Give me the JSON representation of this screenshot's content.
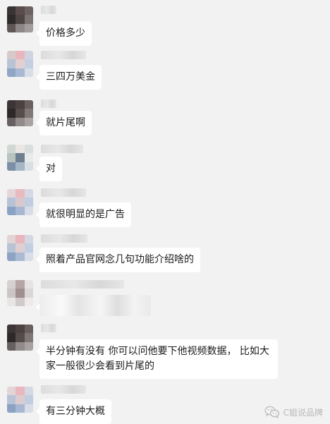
{
  "messages": [
    {
      "text": "价格多少"
    },
    {
      "text": "三四万美金"
    },
    {
      "text": "就片尾啊"
    },
    {
      "text": "对"
    },
    {
      "text": "就很明显的是广告"
    },
    {
      "text": "照着产品官网念几句功能介绍啥的"
    },
    {
      "text": ""
    },
    {
      "text": "半分钟有没有  你可以问他要下他视频数据， 比如大家一般很少会看到片尾的"
    },
    {
      "text": "有三分钟大概"
    }
  ],
  "watermark": {
    "text": "C姐说品牌",
    "icon": "wechat-icon"
  }
}
